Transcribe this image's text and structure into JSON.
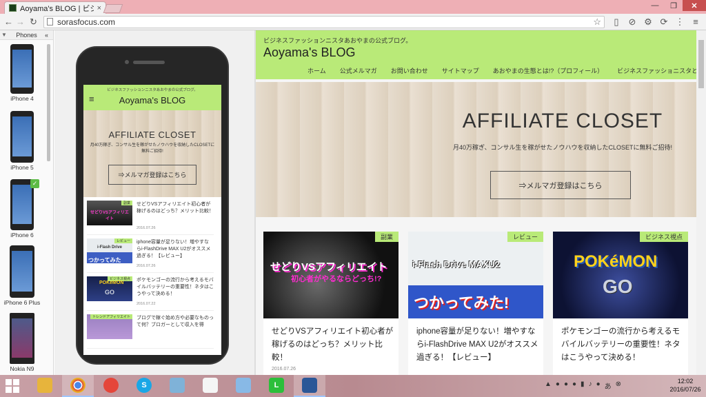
{
  "browser": {
    "tab_title": "Aoyama's BLOG | ビジネ",
    "tab_close": "×",
    "url": "sorasfocus.com",
    "window_min": "—",
    "window_max": "❐",
    "window_close": "✕"
  },
  "device_panel": {
    "header": "Phones",
    "collapse": "«",
    "selected_check": "✓",
    "devices": [
      "iPhone 4",
      "iPhone 5",
      "iPhone 6",
      "iPhone 6 Plus",
      "Nokia N9"
    ]
  },
  "mobile": {
    "tagline": "ビジネスファッションニスタあおやまの公式ブログ。",
    "menu_icon": "≡",
    "title": "Aoyama's BLOG",
    "hero_title": "AFFILIATE CLOSET",
    "hero_sub": "月40万稼ぎ、コンサル生を稼がせたノウハウを収納したCLOSETに無料ご招待!",
    "hero_button": "⇒メルマガ登録はこちら",
    "posts": [
      {
        "badge": "副業",
        "title": "せどりVSアフィリエイト初心者が稼げるのはどっち？メリット比較！",
        "date": "2016.07.26",
        "thumb_text": "せどりVSアフィリエイト"
      },
      {
        "badge": "レビュー",
        "title": "iphone容量が足りない！増やすならi-FlashDrive MAX U2がオススメ過ぎる！【レビュー】",
        "date": "2016.07.26",
        "thumb_text": "i-Flash Drive",
        "thumb_text2": "つかってみた"
      },
      {
        "badge": "ビジネス視点",
        "title": "ポケモンゴーの流行から考えるモバイルバッテリーの重要性！ネタはこうやって決める！",
        "date": "2016.07.22",
        "thumb_text": "POKéMON",
        "thumb_text2": "GO"
      },
      {
        "badge": "トレンドアフィリエイト",
        "title": "ブログで稼ぐ始め方や必要なものって何？ブロガーとして収入を得",
        "date": "",
        "thumb_text": ""
      }
    ]
  },
  "site": {
    "tagline": "ビジネスファッションニスタあおやまの公式ブログ。",
    "title": "Aoyama's BLOG",
    "nav": [
      "ホーム",
      "公式メルマガ",
      "お問い合わせ",
      "サイトマップ",
      "あおやまの生態とは!?（プロフィール）",
      "ビジネスファッショニスタとは。"
    ],
    "hero_title": "AFFILIATE CLOSET",
    "hero_sub": "月40万稼ぎ、コンサル生を稼がせたノウハウを収納したCLOSETに無料ご招待!",
    "hero_button": "⇒メルマガ登録はこちら",
    "cards": [
      {
        "badge": "副業",
        "title": "せどりVSアフィリエイト初心者が稼げるのはどっち？メリット比較！",
        "date": "2016.07.26",
        "img_text1": "せどりVSアフィリエイト",
        "img_text2": "初心者がやるならどっち!?"
      },
      {
        "badge": "レビュー",
        "title": "iphone容量が足りない！増やすならi-FlashDrive MAX U2がオススメ過ぎる！【レビュー】",
        "date": "",
        "img_text1": "i-Flash Drive MAXU2",
        "img_text2": "つかってみた!"
      },
      {
        "badge": "ビジネス視点",
        "title": "ポケモンゴーの流行から考えるモバイルバッテリーの重要性！ネタはこうやって決める！",
        "date": "",
        "img_text1": "POKéMON",
        "img_text2": "GO"
      }
    ]
  },
  "taskbar": {
    "time": "12:02",
    "date": "2016/07/26"
  }
}
